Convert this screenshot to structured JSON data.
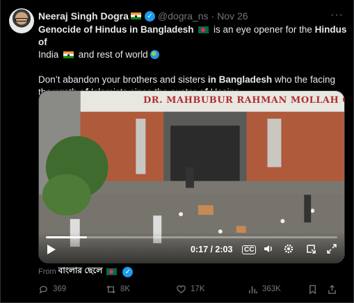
{
  "author": {
    "name": "Neeraj Singh Dogra",
    "handle": "@dogra_ns",
    "separator": "·",
    "date": "Nov 26",
    "more_label": "···"
  },
  "tweet": {
    "p1": {
      "s1": "Genocide of Hindus in Bangladesh",
      "s2": " is an eye opener for the ",
      "s3": "Hindus of",
      "s4": "India",
      "s5": " and rest of world"
    },
    "p2": {
      "s1": "Don’t abandon your brothers and sisters ",
      "s2": "in Bangladesh",
      "s3": " who the facing the wrath ",
      "s4": "of",
      "s5": " Islamists since the ouster ",
      "s6": "of",
      "s7": " Hasina"
    }
  },
  "video": {
    "sign_text": "DR. MAHBUBUR RAHMAN MOLLAH COLLEGE",
    "time": "0:17 / 2:03",
    "progress_fraction": 0.14,
    "cc_label": "CC"
  },
  "source": {
    "prefix": "From",
    "name": "বাংলার ছেলে"
  },
  "actions": {
    "replies": "369",
    "reposts": "8K",
    "likes": "17K",
    "views": "363K"
  },
  "colors": {
    "background": "#000000",
    "text": "#e7e9ea",
    "secondary": "#71767b",
    "verified": "#1d9bf0"
  }
}
